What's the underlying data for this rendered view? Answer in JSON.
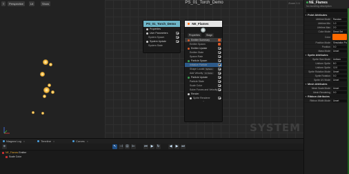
{
  "viewport": {
    "buttons": {
      "menu": "≡",
      "perspective": "Perspective",
      "lit": "Lit",
      "show": "Show"
    }
  },
  "graph": {
    "title": "PS_01_Torch_Demo",
    "zoom": "Zoom 1:1",
    "watermark": "SYSTEM",
    "system_node": {
      "title": "PS_01_Torch_Demo",
      "rows": [
        "Properties",
        "User Parameters",
        "System Spawn",
        "System Update",
        "System State"
      ]
    },
    "emitter_node": {
      "title": "NE_Flames",
      "tags": [
        "Properties",
        "Stage"
      ],
      "rows": [
        "Emitter Summary",
        "Emitter Spawn",
        "Emitter Update",
        "Emitter State",
        "Spawn Rate",
        "Particle Spawn",
        "Initialize Particle",
        "Shape Location",
        "Add Velocity",
        "Particle Update",
        "Particle State",
        "Scale Color",
        "Solve Forces and Velocity",
        "Render",
        "Sprite Renderer"
      ],
      "mini_tags": [
        "Sphere",
        "In Cone",
        "Self"
      ]
    }
  },
  "details": {
    "title": "NE_Flames",
    "subtitle": "No bundling description",
    "sections": [
      {
        "name": "Point Attributes",
        "rows": [
          {
            "label": "Lifetime Mode",
            "value": "Random"
          },
          {
            "label": "Lifetime Min",
            "value": "1.0"
          },
          {
            "label": "Lifetime Max",
            "value": "2.0"
          },
          {
            "label": "Color Mode",
            "value": "Direct Set"
          },
          {
            "label": "Color",
            "value": "",
            "color": "#ff6a00"
          },
          {
            "label": "Position Mode",
            "value": "Simulation Pos"
          },
          {
            "label": "Position",
            "value": "0.0"
          },
          {
            "label": "Mass Mode",
            "value": "Unset"
          }
        ]
      },
      {
        "name": "Sprite Attributes",
        "rows": [
          {
            "label": "Sprite Size Mode",
            "value": "Uniform"
          },
          {
            "label": "Uniform Sprite",
            "value": "8.0"
          },
          {
            "label": "Uniform Sprite",
            "value": "12.0"
          },
          {
            "label": "Sprite Rotation Mode",
            "value": "Unset"
          },
          {
            "label": "Sprite Rotation",
            "value": "0.0"
          },
          {
            "label": "Sprite UV Mode",
            "value": "Unset"
          }
        ]
      },
      {
        "name": "Mesh Attributes",
        "rows": [
          {
            "label": "Mesh Scale Mode",
            "value": "Unset"
          },
          {
            "label": "Mesh Rendering",
            "value": "0.0"
          }
        ]
      },
      {
        "name": "Ribbon Attributes",
        "rows": [
          {
            "label": "Ribbon Width Mode",
            "value": "Unset"
          }
        ]
      }
    ]
  },
  "bottom": {
    "tabs": [
      {
        "label": "Niagara Log"
      },
      {
        "label": "Timeline"
      },
      {
        "label": "Curves"
      }
    ],
    "log": [
      {
        "label": "NE_Flames",
        "status": "Emitter"
      },
      {
        "label": "Scale Color",
        "status": ""
      }
    ]
  },
  "colors": {
    "node_system": "#6fb6c8",
    "node_emitter": "#e6e6e6",
    "accent_orange": "#ff6a00",
    "selection_blue": "#2d5a8a"
  }
}
